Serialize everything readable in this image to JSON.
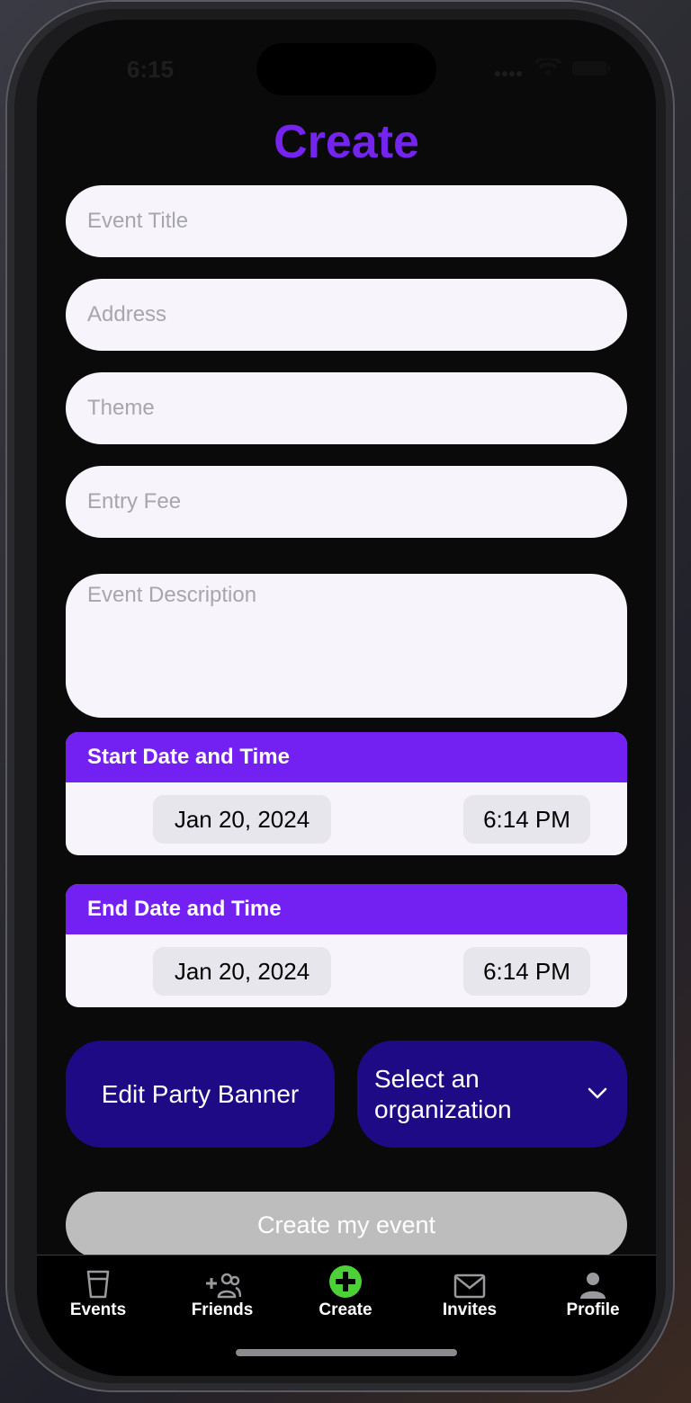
{
  "status": {
    "time": "6:15"
  },
  "page": {
    "title": "Create"
  },
  "form": {
    "event_title_placeholder": "Event Title",
    "address_placeholder": "Address",
    "theme_placeholder": "Theme",
    "entry_fee_placeholder": "Entry Fee",
    "description_placeholder": "Event Description"
  },
  "start": {
    "label": "Start Date and Time",
    "date": "Jan 20, 2024",
    "time": "6:14 PM"
  },
  "end": {
    "label": "End Date and Time",
    "date": "Jan 20, 2024",
    "time": "6:14 PM"
  },
  "actions": {
    "edit_banner": "Edit Party Banner",
    "organization_select": "Select an organization",
    "create": "Create my event"
  },
  "tabs": [
    {
      "label": "Events",
      "icon": "cup-icon"
    },
    {
      "label": "Friends",
      "icon": "add-friends-icon"
    },
    {
      "label": "Create",
      "icon": "plus-circle-icon"
    },
    {
      "label": "Invites",
      "icon": "envelope-icon"
    },
    {
      "label": "Profile",
      "icon": "person-icon"
    }
  ],
  "colors": {
    "accent": "#7524f0",
    "header_purple": "#7320f2",
    "button_navy": "#1e0a85",
    "create_active": "#4cd137"
  }
}
